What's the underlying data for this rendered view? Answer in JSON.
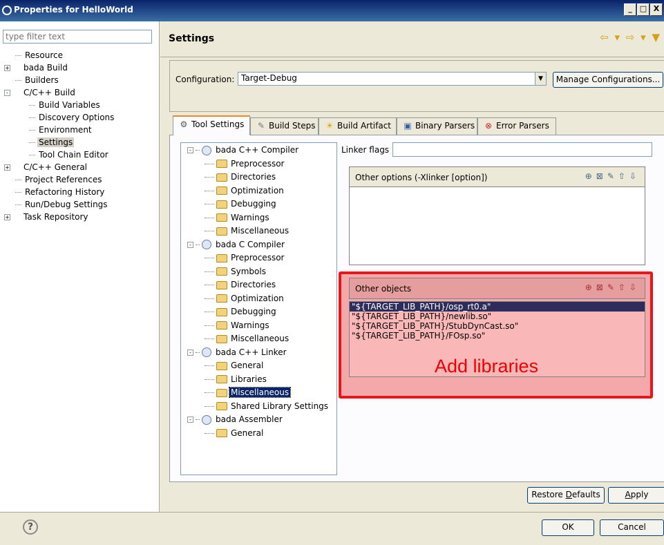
{
  "window": {
    "title": "Properties for HelloWorld",
    "controls": [
      "_",
      "□",
      "X"
    ]
  },
  "sidebar": {
    "filter_placeholder": "type filter text",
    "items": [
      {
        "label": "Resource",
        "level": 0,
        "expander": ""
      },
      {
        "label": "bada Build",
        "level": 0,
        "expander": "+"
      },
      {
        "label": "Builders",
        "level": 0,
        "expander": ""
      },
      {
        "label": "C/C++ Build",
        "level": 0,
        "expander": "-"
      },
      {
        "label": "Build Variables",
        "level": 1,
        "expander": ""
      },
      {
        "label": "Discovery Options",
        "level": 1,
        "expander": ""
      },
      {
        "label": "Environment",
        "level": 1,
        "expander": ""
      },
      {
        "label": "Settings",
        "level": 1,
        "expander": "",
        "selected": true
      },
      {
        "label": "Tool Chain Editor",
        "level": 1,
        "expander": ""
      },
      {
        "label": "C/C++ General",
        "level": 0,
        "expander": "+"
      },
      {
        "label": "Project References",
        "level": 0,
        "expander": ""
      },
      {
        "label": "Refactoring History",
        "level": 0,
        "expander": ""
      },
      {
        "label": "Run/Debug Settings",
        "level": 0,
        "expander": ""
      },
      {
        "label": "Task Repository",
        "level": 0,
        "expander": "+"
      }
    ]
  },
  "header": {
    "title": "Settings"
  },
  "configuration": {
    "label": "Configuration:",
    "value": "Target-Debug",
    "manage_label": "Manage Configurations..."
  },
  "tabs": [
    {
      "label": "Tool Settings",
      "icon": "gear-icon",
      "active": true
    },
    {
      "label": "Build Steps",
      "icon": "steps-icon"
    },
    {
      "label": "Build Artifact",
      "icon": "artifact-icon"
    },
    {
      "label": "Binary Parsers",
      "icon": "binary-icon"
    },
    {
      "label": "Error Parsers",
      "icon": "error-icon"
    }
  ],
  "tool_tree": [
    {
      "label": "bada C++ Compiler",
      "type": "tool"
    },
    {
      "label": "Preprocessor",
      "type": "option"
    },
    {
      "label": "Directories",
      "type": "option"
    },
    {
      "label": "Optimization",
      "type": "option"
    },
    {
      "label": "Debugging",
      "type": "option"
    },
    {
      "label": "Warnings",
      "type": "option"
    },
    {
      "label": "Miscellaneous",
      "type": "option"
    },
    {
      "label": "bada C Compiler",
      "type": "tool"
    },
    {
      "label": "Preprocessor",
      "type": "option"
    },
    {
      "label": "Symbols",
      "type": "option"
    },
    {
      "label": "Directories",
      "type": "option"
    },
    {
      "label": "Optimization",
      "type": "option"
    },
    {
      "label": "Debugging",
      "type": "option"
    },
    {
      "label": "Warnings",
      "type": "option"
    },
    {
      "label": "Miscellaneous",
      "type": "option"
    },
    {
      "label": "bada C++ Linker",
      "type": "tool"
    },
    {
      "label": "General",
      "type": "option"
    },
    {
      "label": "Libraries",
      "type": "option"
    },
    {
      "label": "Miscellaneous",
      "type": "option",
      "selected": true
    },
    {
      "label": "Shared Library Settings",
      "type": "option"
    },
    {
      "label": "bada Assembler",
      "type": "tool"
    },
    {
      "label": "General",
      "type": "option"
    }
  ],
  "linker": {
    "flags_label": "Linker flags",
    "flags_value": "",
    "other_options_label": "Other options (-Xlinker [option])",
    "other_objects_label": "Other objects",
    "objects": [
      "\"${TARGET_LIB_PATH}/osp_rt0.a\"",
      "\"${TARGET_LIB_PATH}/newlib.so\"",
      "\"${TARGET_LIB_PATH}/StubDynCast.so\"",
      "\"${TARGET_LIB_PATH}/FOsp.so\""
    ],
    "annotation": "Add libraries"
  },
  "buttons": {
    "restore_pre": "Restore ",
    "restore_key": "D",
    "restore_post": "efaults",
    "apply_key": "A",
    "apply_post": "pply",
    "ok": "OK",
    "cancel": "Cancel"
  },
  "colors": {
    "highlight": "#e8161b",
    "annotation": "#ee0000",
    "selection": "#0a246a"
  }
}
